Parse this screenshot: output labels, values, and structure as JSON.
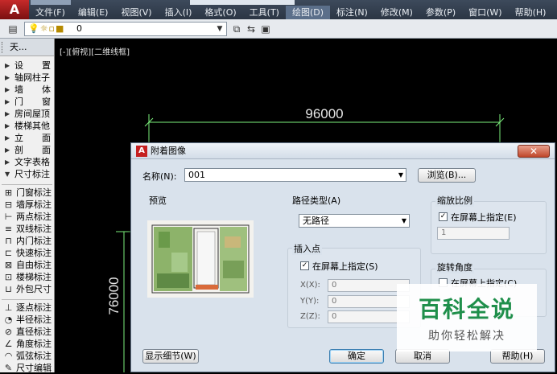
{
  "menu": {
    "items": [
      "文件(F)",
      "编辑(E)",
      "视图(V)",
      "插入(I)",
      "格式(O)",
      "工具(T)",
      "绘图(D)",
      "标注(N)",
      "修改(M)",
      "参数(P)",
      "窗口(W)",
      "帮助(H)"
    ]
  },
  "layer": {
    "value": "0"
  },
  "panel": {
    "title": "天...",
    "categories": [
      {
        "a": "设",
        "b": "置"
      },
      {
        "a": "轴网柱子",
        "b": ""
      },
      {
        "a": "墙",
        "b": "体"
      },
      {
        "a": "门",
        "b": "窗"
      },
      {
        "a": "房间屋顶",
        "b": ""
      },
      {
        "a": "楼梯其他",
        "b": ""
      },
      {
        "a": "立",
        "b": "面"
      },
      {
        "a": "剖",
        "b": "面"
      },
      {
        "a": "文字表格",
        "b": ""
      },
      {
        "a": "尺寸标注",
        "b": ""
      }
    ],
    "tools": [
      "门窗标注",
      "墙厚标注",
      "两点标注",
      "双线标注",
      "内门标注",
      "快速标注",
      "自由标注",
      "楼梯标注",
      "外包尺寸"
    ],
    "tools2": [
      "逐点标注",
      "半径标注",
      "直径标注",
      "角度标注",
      "弧弦标注",
      "尺寸编辑"
    ]
  },
  "viewport": {
    "label": "[-][俯视][二维线框]"
  },
  "drawing": {
    "dim_horizontal": "96000",
    "dim_vertical": "76000"
  },
  "dialog": {
    "title": "附着图像",
    "name_label": "名称(N):",
    "name_value": "001",
    "browse": "浏览(B)...",
    "preview_label": "预览",
    "path_type_label": "路径类型(A)",
    "path_type_value": "无路径",
    "insert_point_label": "插入点",
    "insert_on_screen": "在屏幕上指定(S)",
    "x_label": "X(X):",
    "y_label": "Y(Y):",
    "z_label": "Z(Z):",
    "x_value": "0",
    "y_value": "0",
    "z_value": "0",
    "scale_label": "缩放比例",
    "scale_on_screen": "在屏幕上指定(E)",
    "scale_value": "1",
    "rotation_label": "旋转角度",
    "rotation_on_screen": "在屏幕上指定(C)",
    "details": "显示细节(W)",
    "ok": "确定",
    "cancel": "取消",
    "help": "帮助(H)"
  },
  "watermark": {
    "main": "百科全说",
    "sub": "助你轻松解决"
  }
}
